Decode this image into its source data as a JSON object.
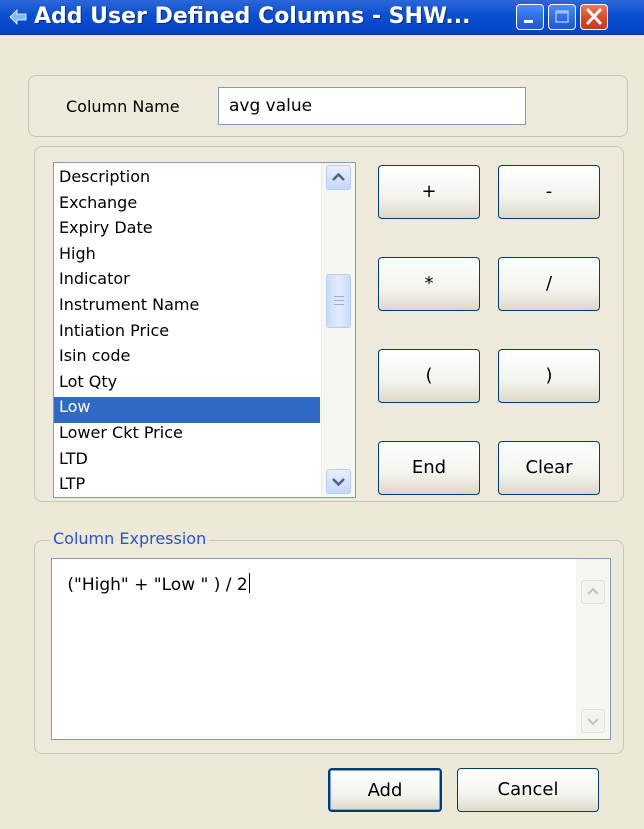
{
  "window": {
    "title": "Add User Defined Columns - SHW...",
    "icons": {
      "app": "app-icon",
      "minimize": "minimize-icon",
      "maximize": "maximize-icon",
      "close": "close-icon"
    }
  },
  "column_name": {
    "label": "Column Name",
    "value": "avg value"
  },
  "field_list": {
    "items": [
      "Description",
      "Exchange",
      "Expiry Date",
      "High",
      "Indicator",
      "Instrument Name",
      "Intiation Price",
      "Isin code",
      "Lot Qty",
      "Low",
      "Lower Ckt Price",
      "LTD",
      "LTP"
    ],
    "selected": "Low"
  },
  "operators": {
    "plus": "+",
    "minus": "-",
    "multiply": "*",
    "divide": "/",
    "open_paren": "(",
    "close_paren": ")",
    "end": "End",
    "clear": "Clear"
  },
  "expression": {
    "legend": "Column Expression",
    "value": " (\"High\" + \"Low \" ) / 2"
  },
  "actions": {
    "add": "Add",
    "cancel": "Cancel"
  },
  "colors": {
    "titlebar": "#0a4fd0",
    "selection": "#316ac5",
    "legend_text": "#2c52c8",
    "dialog_bg": "#ece9d8"
  }
}
